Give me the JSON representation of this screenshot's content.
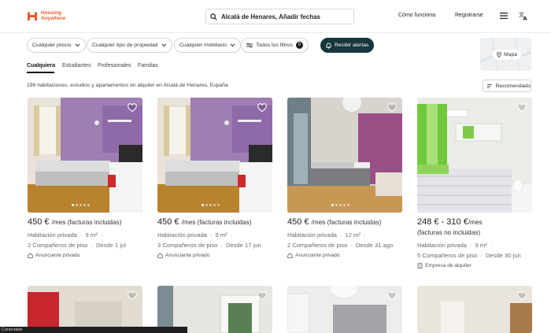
{
  "header": {
    "logo_line1": "Housing",
    "logo_line2": "Anywhere",
    "search_text": "Alcalá de Henares, Añadir fechas",
    "how_it_works": "Cómo funciona",
    "register": "Registrarse",
    "brand_color": "#f0582a"
  },
  "filters": {
    "price": "Cualquier precio",
    "property_type": "Cualquier tipo de propiedad",
    "furniture": "Cualquier mobiliario",
    "all_filters": "Todos los filtros",
    "all_filters_count": "0",
    "alerts": "Recibir alertas",
    "map": "Mapa"
  },
  "tabs": [
    "Cualquiera",
    "Estudiantes",
    "Profesionales",
    "Familias"
  ],
  "results": {
    "count_text": "198 habitaciones, estudios y apartamentos en alquiler en Alcalá de Henares, España",
    "sort_label": "Recomendado"
  },
  "listings": [
    {
      "price": "450 €",
      "price_suffix": "/mes (facturas incluidas)",
      "type": "Habitación privada",
      "size": "9 m²",
      "roommates": "2 Compañeros de piso",
      "available": "Desde 1 jul",
      "owner": "Anunciante privado"
    },
    {
      "price": "450 €",
      "price_suffix": "/mes (facturas incluidas)",
      "type": "Habitación privada",
      "size": "9 m²",
      "roommates": "3 Compañeros de piso",
      "available": "Desde 17 jun",
      "owner": "Anunciante privado"
    },
    {
      "price": "450 €",
      "price_suffix": "/mes (facturas incluidas)",
      "type": "Habitación privada",
      "size": "12 m²",
      "roommates": "2 Compañeros de piso",
      "available": "Desde 31 ago",
      "owner": "Anunciante privado"
    },
    {
      "price": "248 € - 310 €",
      "price_suffix": "/mes",
      "price_note": "(facturas no incluidas)",
      "type": "Habitación privada",
      "size": "9 m²",
      "roommates": "5 Compañeros de piso",
      "available": "Desde 30 jun",
      "owner": "Empresa de alquiler"
    }
  ],
  "status_bar": "Conectado"
}
